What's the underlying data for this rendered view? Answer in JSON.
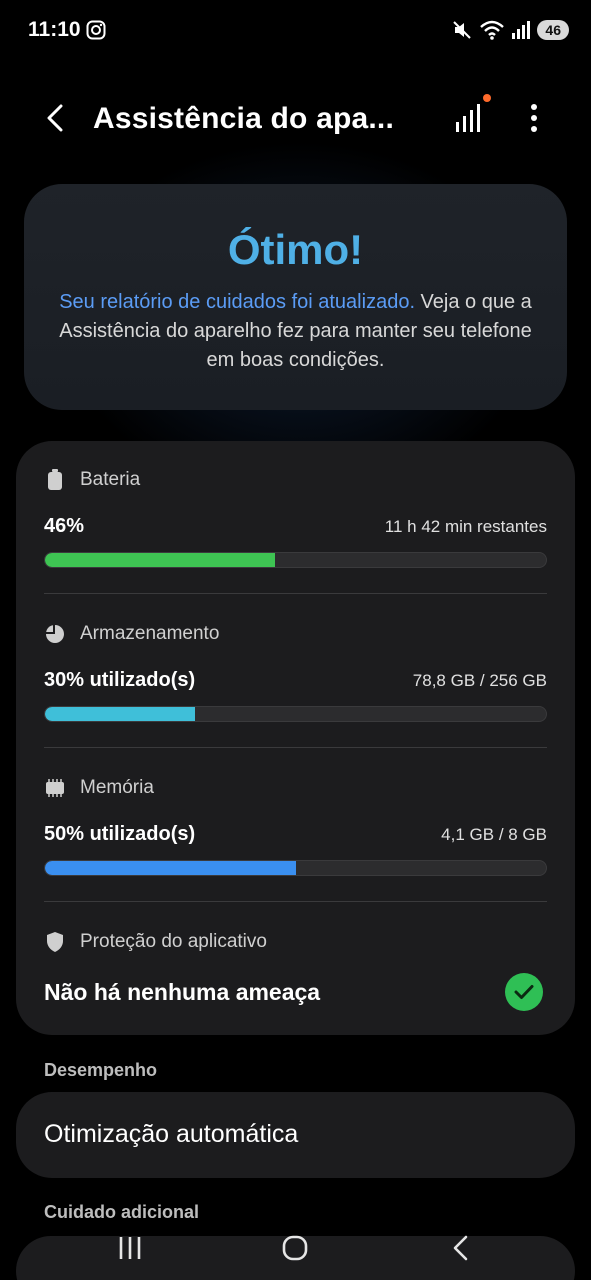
{
  "status_bar": {
    "time": "11:10",
    "battery_level": "46",
    "icons": [
      "instagram-icon",
      "mute-icon",
      "wifi-icon",
      "signal-icon",
      "battery-icon"
    ]
  },
  "header": {
    "title": "Assistência do apa...",
    "back_icon": "chevron-left-icon",
    "report_icon": "signal-bars-icon",
    "menu_icon": "more-vertical-icon"
  },
  "hero": {
    "title": "Ótimo!",
    "link_text": "Seu relatório de cuidados foi atualizado.",
    "body_text": " Veja o que a Assistência do aparelho fez para manter seu telefone em boas condições."
  },
  "stats": {
    "battery": {
      "label": "Bateria",
      "value": "46%",
      "detail": "11 h 42 min restantes",
      "fraction": 0.46,
      "color": "#3ec453"
    },
    "storage": {
      "label": "Armazenamento",
      "value": "30% utilizado(s)",
      "detail": "78,8 GB / 256 GB",
      "fraction": 0.3,
      "color": "#3fbfd9"
    },
    "memory": {
      "label": "Memória",
      "value": "50% utilizado(s)",
      "detail": "4,1 GB / 8 GB",
      "fraction": 0.5,
      "color": "#3a8ff0"
    },
    "protection": {
      "label": "Proteção do aplicativo",
      "value": "Não há nenhuma ameaça"
    }
  },
  "performance": {
    "section_label": "Desempenho",
    "item_label": "Otimização automática"
  },
  "extra_care": {
    "section_label": "Cuidado adicional"
  },
  "nav": {
    "icons": [
      "recent-apps-icon",
      "home-icon",
      "back-icon"
    ]
  }
}
